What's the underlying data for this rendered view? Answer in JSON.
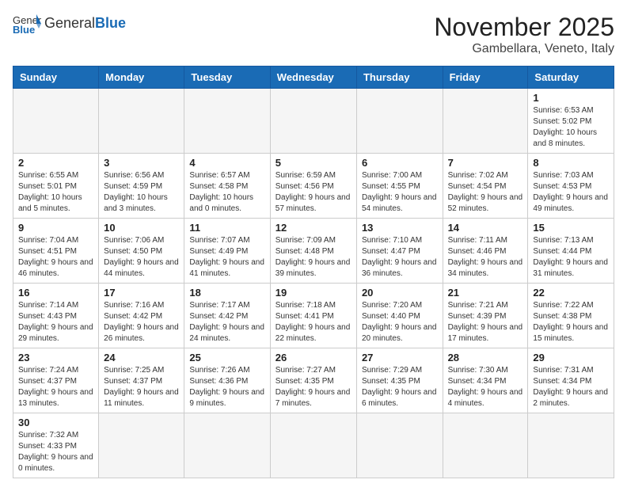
{
  "header": {
    "logo_general": "General",
    "logo_blue": "Blue",
    "month_title": "November 2025",
    "location": "Gambellara, Veneto, Italy"
  },
  "weekdays": [
    "Sunday",
    "Monday",
    "Tuesday",
    "Wednesday",
    "Thursday",
    "Friday",
    "Saturday"
  ],
  "weeks": [
    [
      {
        "day": "",
        "info": ""
      },
      {
        "day": "",
        "info": ""
      },
      {
        "day": "",
        "info": ""
      },
      {
        "day": "",
        "info": ""
      },
      {
        "day": "",
        "info": ""
      },
      {
        "day": "",
        "info": ""
      },
      {
        "day": "1",
        "info": "Sunrise: 6:53 AM\nSunset: 5:02 PM\nDaylight: 10 hours and 8 minutes."
      }
    ],
    [
      {
        "day": "2",
        "info": "Sunrise: 6:55 AM\nSunset: 5:01 PM\nDaylight: 10 hours and 5 minutes."
      },
      {
        "day": "3",
        "info": "Sunrise: 6:56 AM\nSunset: 4:59 PM\nDaylight: 10 hours and 3 minutes."
      },
      {
        "day": "4",
        "info": "Sunrise: 6:57 AM\nSunset: 4:58 PM\nDaylight: 10 hours and 0 minutes."
      },
      {
        "day": "5",
        "info": "Sunrise: 6:59 AM\nSunset: 4:56 PM\nDaylight: 9 hours and 57 minutes."
      },
      {
        "day": "6",
        "info": "Sunrise: 7:00 AM\nSunset: 4:55 PM\nDaylight: 9 hours and 54 minutes."
      },
      {
        "day": "7",
        "info": "Sunrise: 7:02 AM\nSunset: 4:54 PM\nDaylight: 9 hours and 52 minutes."
      },
      {
        "day": "8",
        "info": "Sunrise: 7:03 AM\nSunset: 4:53 PM\nDaylight: 9 hours and 49 minutes."
      }
    ],
    [
      {
        "day": "9",
        "info": "Sunrise: 7:04 AM\nSunset: 4:51 PM\nDaylight: 9 hours and 46 minutes."
      },
      {
        "day": "10",
        "info": "Sunrise: 7:06 AM\nSunset: 4:50 PM\nDaylight: 9 hours and 44 minutes."
      },
      {
        "day": "11",
        "info": "Sunrise: 7:07 AM\nSunset: 4:49 PM\nDaylight: 9 hours and 41 minutes."
      },
      {
        "day": "12",
        "info": "Sunrise: 7:09 AM\nSunset: 4:48 PM\nDaylight: 9 hours and 39 minutes."
      },
      {
        "day": "13",
        "info": "Sunrise: 7:10 AM\nSunset: 4:47 PM\nDaylight: 9 hours and 36 minutes."
      },
      {
        "day": "14",
        "info": "Sunrise: 7:11 AM\nSunset: 4:46 PM\nDaylight: 9 hours and 34 minutes."
      },
      {
        "day": "15",
        "info": "Sunrise: 7:13 AM\nSunset: 4:44 PM\nDaylight: 9 hours and 31 minutes."
      }
    ],
    [
      {
        "day": "16",
        "info": "Sunrise: 7:14 AM\nSunset: 4:43 PM\nDaylight: 9 hours and 29 minutes."
      },
      {
        "day": "17",
        "info": "Sunrise: 7:16 AM\nSunset: 4:42 PM\nDaylight: 9 hours and 26 minutes."
      },
      {
        "day": "18",
        "info": "Sunrise: 7:17 AM\nSunset: 4:42 PM\nDaylight: 9 hours and 24 minutes."
      },
      {
        "day": "19",
        "info": "Sunrise: 7:18 AM\nSunset: 4:41 PM\nDaylight: 9 hours and 22 minutes."
      },
      {
        "day": "20",
        "info": "Sunrise: 7:20 AM\nSunset: 4:40 PM\nDaylight: 9 hours and 20 minutes."
      },
      {
        "day": "21",
        "info": "Sunrise: 7:21 AM\nSunset: 4:39 PM\nDaylight: 9 hours and 17 minutes."
      },
      {
        "day": "22",
        "info": "Sunrise: 7:22 AM\nSunset: 4:38 PM\nDaylight: 9 hours and 15 minutes."
      }
    ],
    [
      {
        "day": "23",
        "info": "Sunrise: 7:24 AM\nSunset: 4:37 PM\nDaylight: 9 hours and 13 minutes."
      },
      {
        "day": "24",
        "info": "Sunrise: 7:25 AM\nSunset: 4:37 PM\nDaylight: 9 hours and 11 minutes."
      },
      {
        "day": "25",
        "info": "Sunrise: 7:26 AM\nSunset: 4:36 PM\nDaylight: 9 hours and 9 minutes."
      },
      {
        "day": "26",
        "info": "Sunrise: 7:27 AM\nSunset: 4:35 PM\nDaylight: 9 hours and 7 minutes."
      },
      {
        "day": "27",
        "info": "Sunrise: 7:29 AM\nSunset: 4:35 PM\nDaylight: 9 hours and 6 minutes."
      },
      {
        "day": "28",
        "info": "Sunrise: 7:30 AM\nSunset: 4:34 PM\nDaylight: 9 hours and 4 minutes."
      },
      {
        "day": "29",
        "info": "Sunrise: 7:31 AM\nSunset: 4:34 PM\nDaylight: 9 hours and 2 minutes."
      }
    ],
    [
      {
        "day": "30",
        "info": "Sunrise: 7:32 AM\nSunset: 4:33 PM\nDaylight: 9 hours and 0 minutes."
      },
      {
        "day": "",
        "info": ""
      },
      {
        "day": "",
        "info": ""
      },
      {
        "day": "",
        "info": ""
      },
      {
        "day": "",
        "info": ""
      },
      {
        "day": "",
        "info": ""
      },
      {
        "day": "",
        "info": ""
      }
    ]
  ]
}
